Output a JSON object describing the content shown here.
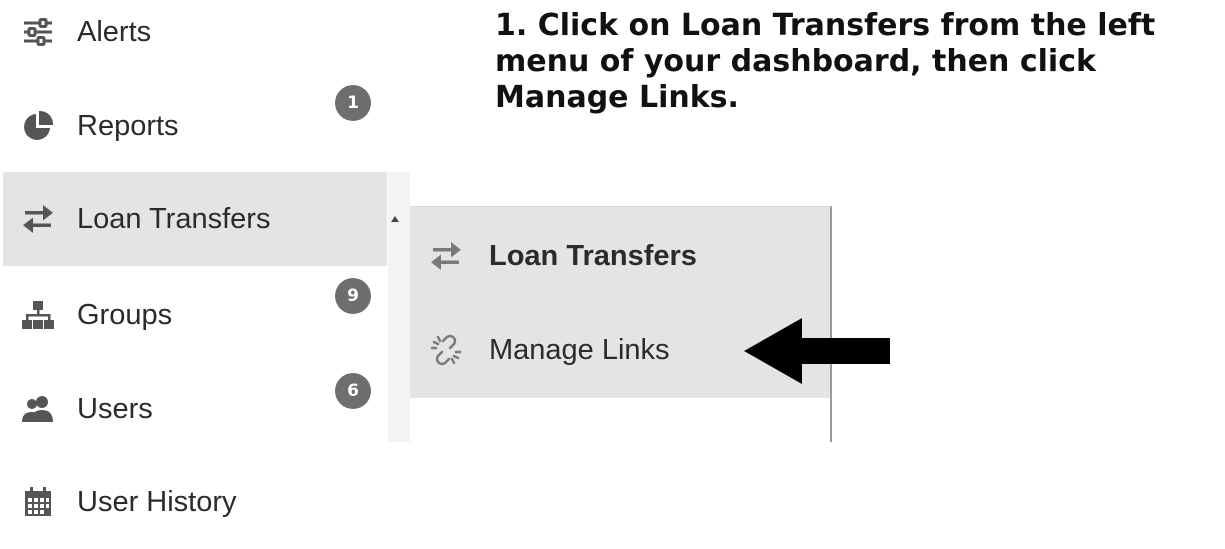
{
  "sidebar": {
    "items": [
      {
        "label": "Alerts",
        "icon": "sliders-icon"
      },
      {
        "label": "Reports",
        "icon": "pie-chart-icon",
        "badge": "1"
      },
      {
        "label": "Loan Transfers",
        "icon": "transfer-arrows-icon",
        "active": true
      },
      {
        "label": "Groups",
        "icon": "sitemap-icon",
        "badge": "9"
      },
      {
        "label": "Users",
        "icon": "users-icon",
        "badge": "6"
      },
      {
        "label": "User History",
        "icon": "calendar-icon"
      }
    ]
  },
  "submenu": {
    "header": {
      "label": "Loan Transfers",
      "icon": "transfer-arrows-icon"
    },
    "items": [
      {
        "label": "Manage Links",
        "icon": "broken-link-icon"
      }
    ]
  },
  "instruction": {
    "text": "1. Click on Loan Transfers from the left menu of your dashboard, then click Manage Links."
  },
  "colors": {
    "active_bg": "#e4e4e4",
    "badge_bg": "#6e6e6e",
    "icon": "#555555"
  }
}
